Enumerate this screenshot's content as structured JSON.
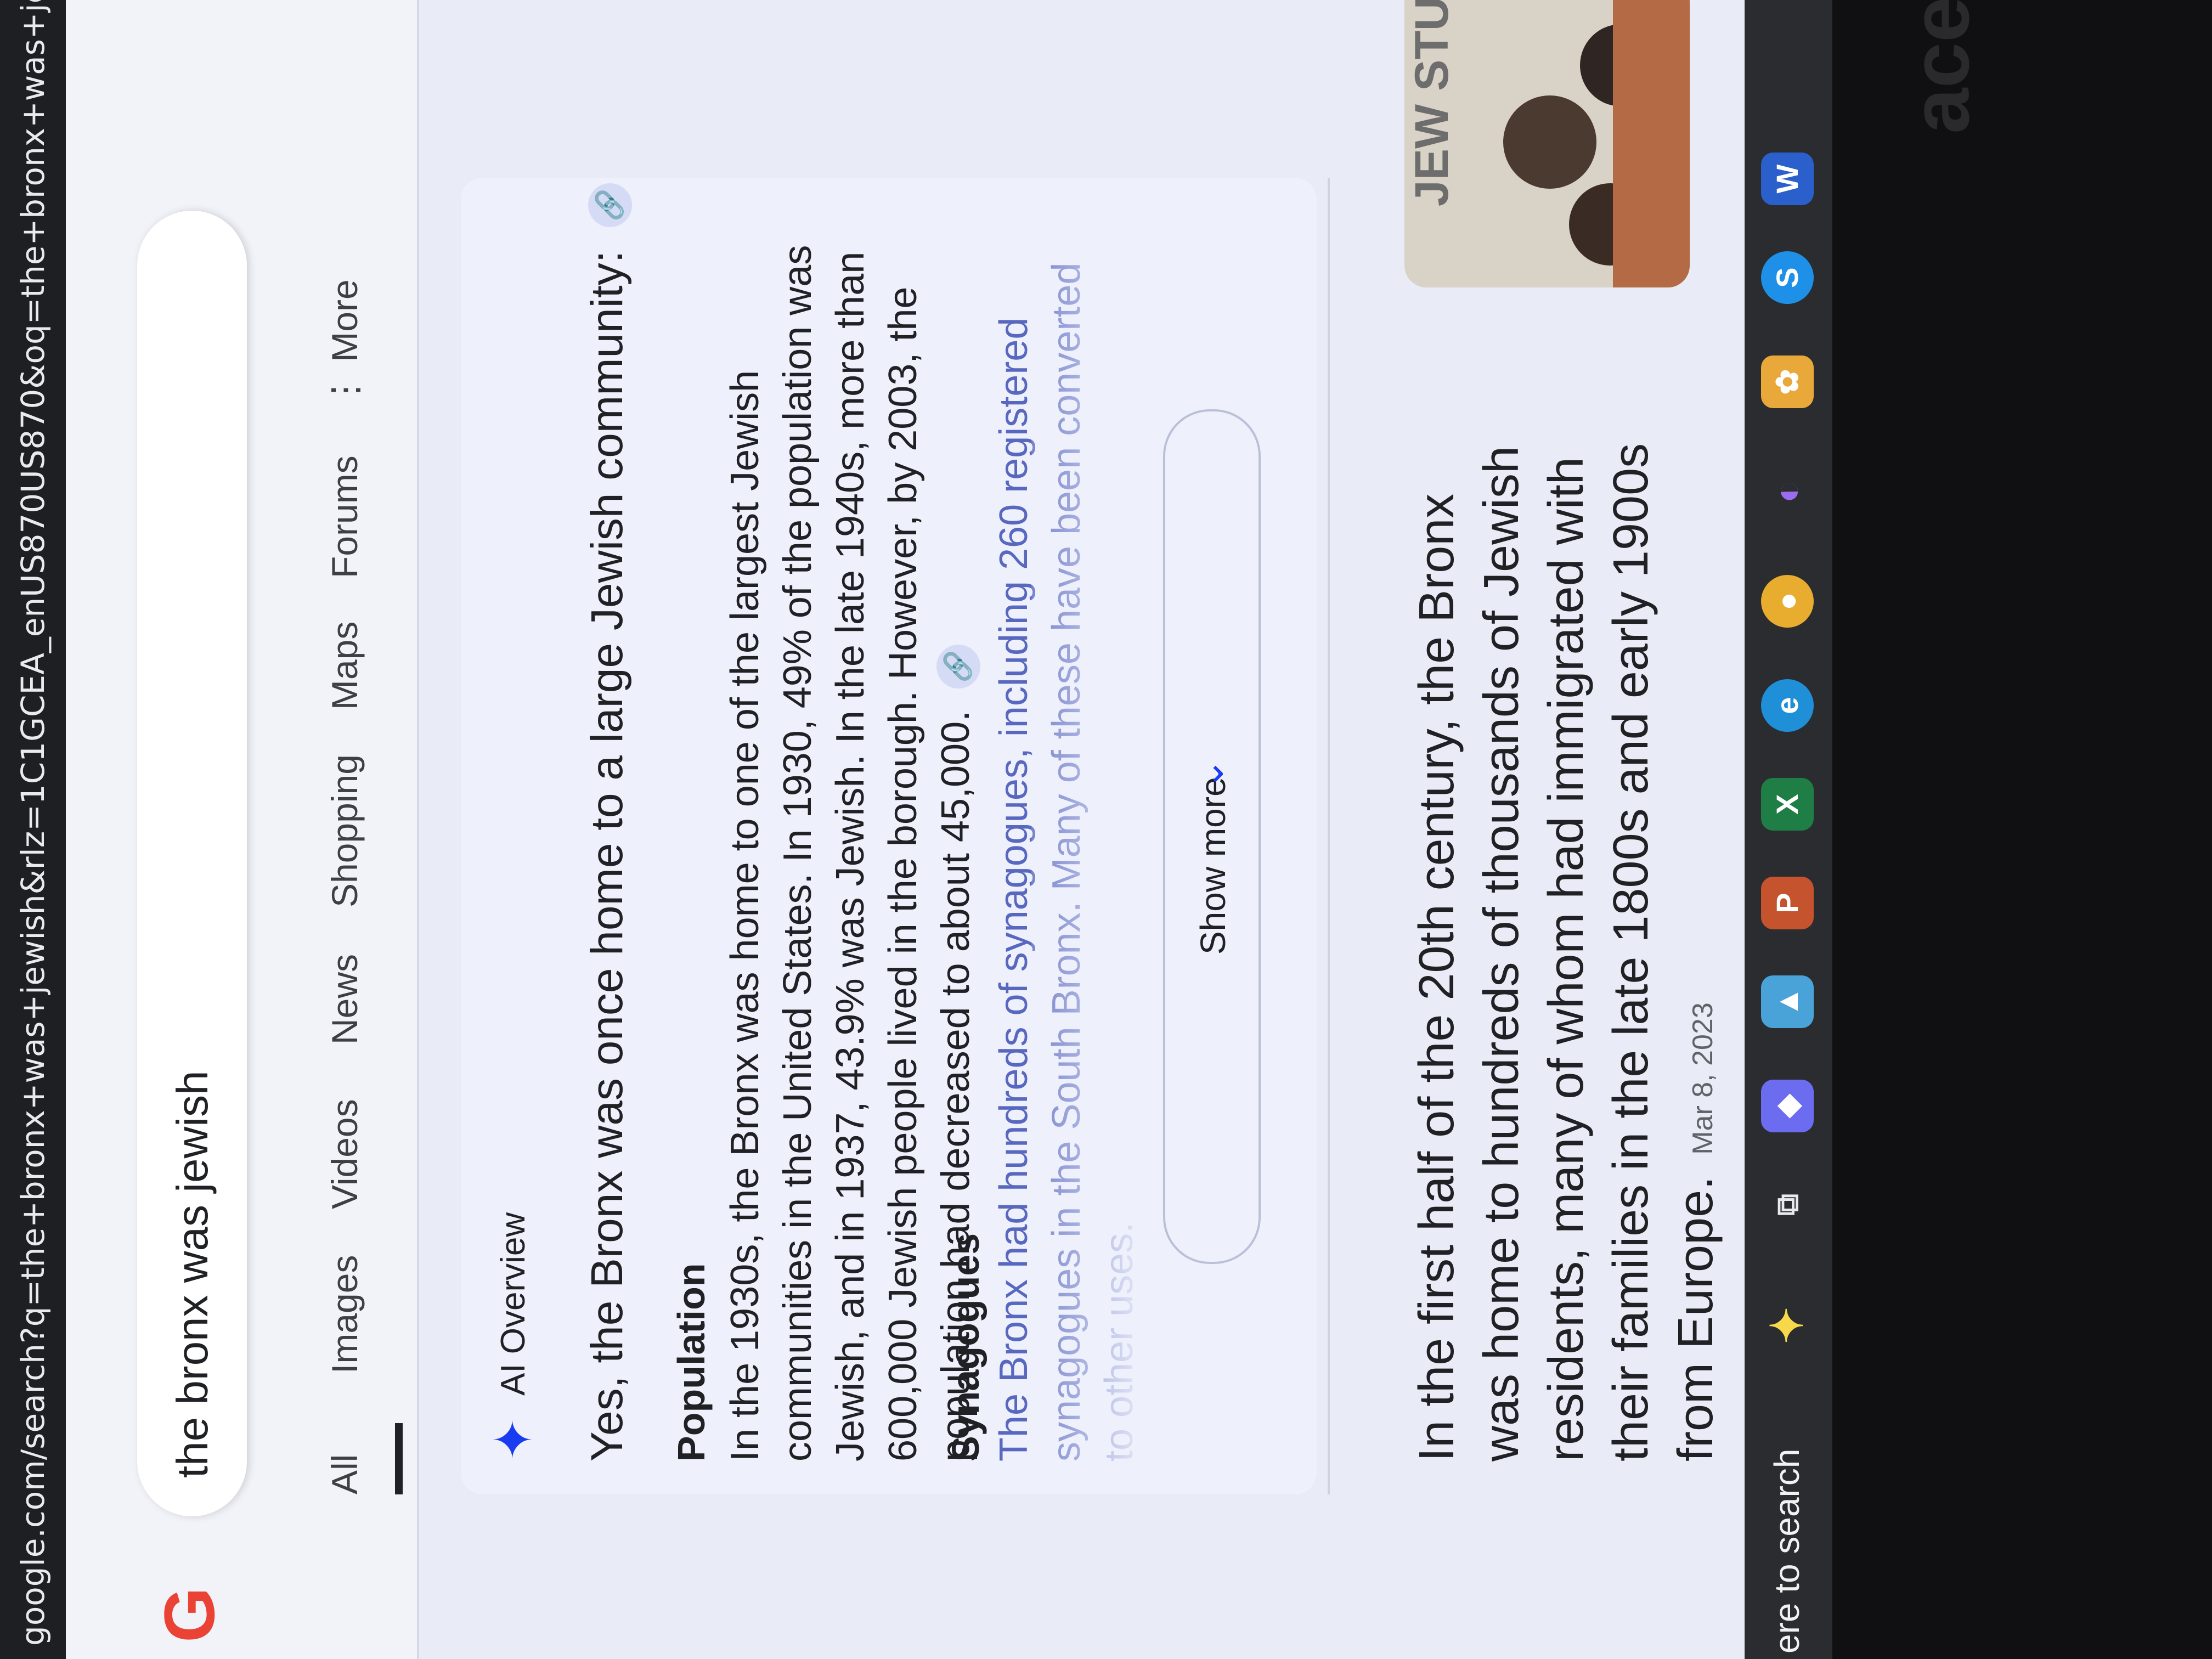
{
  "browser": {
    "url": "google.com/search?q=the+bronx+was+jewish&rlz=1C1GCEA_enUS870US870&oq=the+bronx+was+jewish+&gs"
  },
  "search": {
    "logo_text": "G",
    "query": "the bronx was jewish"
  },
  "tabs": [
    {
      "label": "All",
      "active": true
    },
    {
      "label": "Images"
    },
    {
      "label": "Videos"
    },
    {
      "label": "News"
    },
    {
      "label": "Shopping"
    },
    {
      "label": "Maps"
    },
    {
      "label": "Forums"
    },
    {
      "label": "More"
    }
  ],
  "ai_overview": {
    "label": "AI Overview",
    "headline": "Yes, the Bronx was once home to a large Jewish community:",
    "sections": [
      {
        "heading": "Population",
        "body": "In the 1930s, the Bronx was home to one of the largest Jewish communities in the United States. In 1930, 49% of the population was Jewish, and in 1937, 43.9% was Jewish. In the late 1940s, more than 600,000 Jewish people lived in the borough. However, by 2003, the population had decreased to about 45,000."
      },
      {
        "heading": "Synagogues",
        "body": "The Bronx had hundreds of synagogues, including 260 registered synagogues in the South Bronx. Many of these have been converted to other uses."
      }
    ],
    "show_more_label": "Show more"
  },
  "featured_snippet": {
    "text": "In the first half of the 20th century, the Bronx was home to hundreds of thousands of Jewish residents, many of whom had immigrated with their families in the late 1800s and early 1900s from Europe.",
    "date": "Mar 8, 2023",
    "thumbnail_text": "JEW STU"
  },
  "taskbar": {
    "search_text": "ere to search",
    "icons": [
      "copilot-icon",
      "task-view-icon",
      "copilot-app-icon",
      "photos-icon",
      "powerpoint-icon",
      "excel-icon",
      "edge-icon",
      "chrome-icon",
      "edge-copilot-icon",
      "paint-icon",
      "skype-icon",
      "word-icon"
    ]
  },
  "bezel": {
    "logo_text": "acer"
  },
  "colors": {
    "accent": "#1a3cf0",
    "page_bg": "#e9ecf6",
    "taskbar": "#2b2c30"
  }
}
